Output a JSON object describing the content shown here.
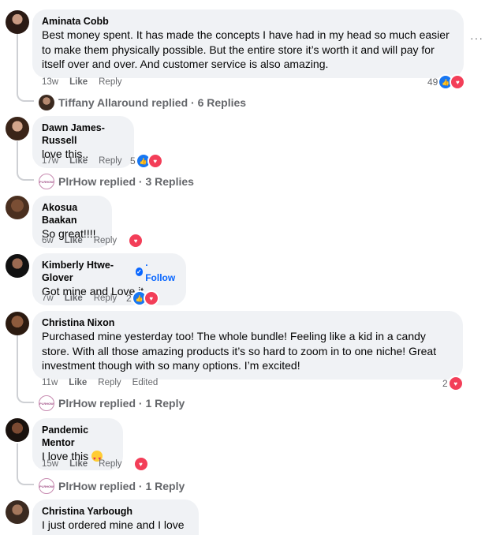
{
  "comments": [
    {
      "author": "Aminata Cobb",
      "text": "Best money spent. It has made the concepts I have had in my head so much easier to make them physically possible. But the entire store it’s worth it and will pay for itself over and over. And customer service is also amazing.",
      "time": "13w",
      "like": "Like",
      "reply": "Reply",
      "reactions": "49",
      "replies_summary": "Tiffany Allaround replied · 6 Replies"
    },
    {
      "author": "Dawn James-Russell",
      "text": "love this..",
      "time": "17w",
      "like": "Like",
      "reply": "Reply",
      "reactions": "5",
      "replies_summary": "PlrHow replied · 3 Replies"
    },
    {
      "author": "Akosua Baakan",
      "text": "So great!!!!",
      "time": "6w",
      "like": "Like",
      "reply": "Reply"
    },
    {
      "author": "Kimberly Htwe-Glover",
      "follow": "Follow",
      "text": "Got mine and Love it",
      "time": "7w",
      "like": "Like",
      "reply": "Reply",
      "reactions": "2"
    },
    {
      "author": "Christina Nixon",
      "text": "Purchased mine yesterday too! The whole bundle! Feeling like a kid in a candy store. With all those amazing products it’s so hard to zoom in to one niche! Great investment though with so many options. I’m excited!",
      "time": "11w",
      "like": "Like",
      "reply": "Reply",
      "edited": "Edited",
      "reactions": "2",
      "replies_summary": "PlrHow replied · 1 Reply"
    },
    {
      "author": "Pandemic Mentor",
      "text": "I love this",
      "time": "15w",
      "like": "Like",
      "reply": "Reply",
      "replies_summary": "PlrHow replied · 1 Reply"
    },
    {
      "author": "Christina Yarbough",
      "text": "I just ordered mine and I love it!"
    }
  ],
  "more_options": "···",
  "colors": {
    "like": "#1877f2",
    "love": "#f33e58",
    "link": "#0866ff"
  }
}
